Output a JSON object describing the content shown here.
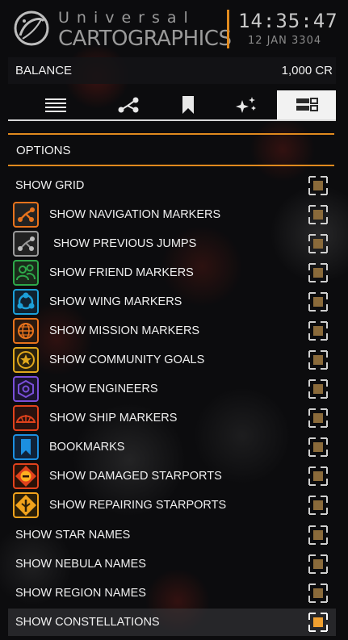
{
  "header": {
    "brand_line1": "Universal",
    "brand_line2": "CARTOGRAPHICS",
    "time": "14:35:47",
    "date": "12 JAN 3304"
  },
  "balance": {
    "label": "BALANCE",
    "value": "1,000 CR"
  },
  "tabs": [
    {
      "icon": "list-icon",
      "active": false
    },
    {
      "icon": "route-icon",
      "active": false
    },
    {
      "icon": "bookmark-icon",
      "active": false
    },
    {
      "icon": "sparkle-icon",
      "active": false
    },
    {
      "icon": "options-icon",
      "active": true
    }
  ],
  "options": {
    "title": "OPTIONS",
    "items": [
      {
        "label": "SHOW GRID",
        "icon": null,
        "checked": false
      },
      {
        "label": "SHOW NAVIGATION MARKERS",
        "icon": "navigation-icon",
        "color": "#e8731c",
        "checked": false
      },
      {
        "label": "SHOW PREVIOUS JUMPS",
        "icon": "previous-jumps-icon",
        "color": "#9a9a9a",
        "checked": false
      },
      {
        "label": "SHOW FRIEND MARKERS",
        "icon": "friend-icon",
        "color": "#2ea84a",
        "checked": false
      },
      {
        "label": "SHOW WING MARKERS",
        "icon": "wing-icon",
        "color": "#1c9fd8",
        "checked": false
      },
      {
        "label": "SHOW MISSION MARKERS",
        "icon": "mission-icon",
        "color": "#e8731c",
        "checked": false
      },
      {
        "label": "SHOW COMMUNITY GOALS",
        "icon": "community-goal-icon",
        "color": "#e0a81c",
        "checked": false
      },
      {
        "label": "SHOW ENGINEERS",
        "icon": "engineer-icon",
        "color": "#7a4fd8",
        "checked": false
      },
      {
        "label": "SHOW SHIP MARKERS",
        "icon": "ship-icon",
        "color": "#e0421c",
        "checked": false
      },
      {
        "label": "BOOKMARKS",
        "icon": "bookmark-icon",
        "color": "#1c8fe0",
        "checked": false
      },
      {
        "label": "SHOW DAMAGED STARPORTS",
        "icon": "damaged-starport-icon",
        "color": "#e0421c",
        "checked": false
      },
      {
        "label": "SHOW REPAIRING STARPORTS",
        "icon": "repairing-starport-icon",
        "color": "#f0a21c",
        "checked": false
      },
      {
        "label": "SHOW STAR NAMES",
        "icon": null,
        "checked": false
      },
      {
        "label": "SHOW NEBULA NAMES",
        "icon": null,
        "checked": false
      },
      {
        "label": "SHOW REGION NAMES",
        "icon": null,
        "checked": false
      },
      {
        "label": "SHOW CONSTELLATIONS",
        "icon": null,
        "checked": true
      }
    ]
  },
  "colors": {
    "accent": "#e08a1e",
    "checkbox_fill_off": "#8a6a3a",
    "checkbox_fill_on": "#f0a030"
  }
}
